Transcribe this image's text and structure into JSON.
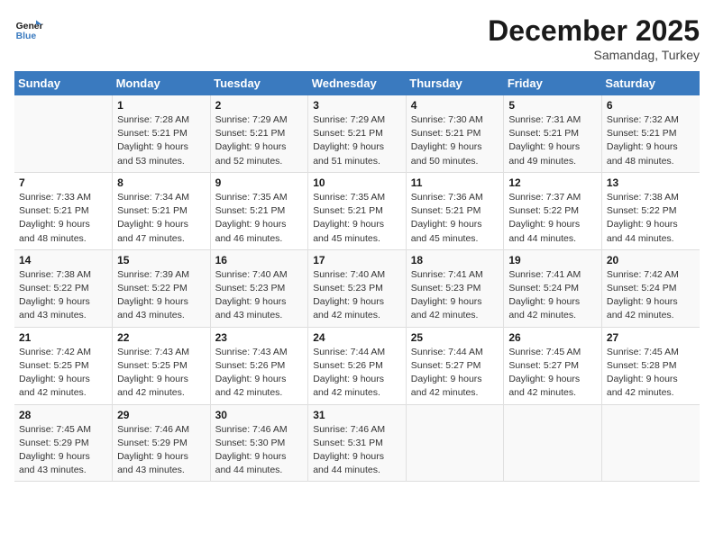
{
  "logo": {
    "line1": "General",
    "line2": "Blue"
  },
  "title": "December 2025",
  "subtitle": "Samandag, Turkey",
  "days_of_week": [
    "Sunday",
    "Monday",
    "Tuesday",
    "Wednesday",
    "Thursday",
    "Friday",
    "Saturday"
  ],
  "weeks": [
    [
      {
        "day": "",
        "info": ""
      },
      {
        "day": "1",
        "info": "Sunrise: 7:28 AM\nSunset: 5:21 PM\nDaylight: 9 hours\nand 53 minutes."
      },
      {
        "day": "2",
        "info": "Sunrise: 7:29 AM\nSunset: 5:21 PM\nDaylight: 9 hours\nand 52 minutes."
      },
      {
        "day": "3",
        "info": "Sunrise: 7:29 AM\nSunset: 5:21 PM\nDaylight: 9 hours\nand 51 minutes."
      },
      {
        "day": "4",
        "info": "Sunrise: 7:30 AM\nSunset: 5:21 PM\nDaylight: 9 hours\nand 50 minutes."
      },
      {
        "day": "5",
        "info": "Sunrise: 7:31 AM\nSunset: 5:21 PM\nDaylight: 9 hours\nand 49 minutes."
      },
      {
        "day": "6",
        "info": "Sunrise: 7:32 AM\nSunset: 5:21 PM\nDaylight: 9 hours\nand 48 minutes."
      }
    ],
    [
      {
        "day": "7",
        "info": "Sunrise: 7:33 AM\nSunset: 5:21 PM\nDaylight: 9 hours\nand 48 minutes."
      },
      {
        "day": "8",
        "info": "Sunrise: 7:34 AM\nSunset: 5:21 PM\nDaylight: 9 hours\nand 47 minutes."
      },
      {
        "day": "9",
        "info": "Sunrise: 7:35 AM\nSunset: 5:21 PM\nDaylight: 9 hours\nand 46 minutes."
      },
      {
        "day": "10",
        "info": "Sunrise: 7:35 AM\nSunset: 5:21 PM\nDaylight: 9 hours\nand 45 minutes."
      },
      {
        "day": "11",
        "info": "Sunrise: 7:36 AM\nSunset: 5:21 PM\nDaylight: 9 hours\nand 45 minutes."
      },
      {
        "day": "12",
        "info": "Sunrise: 7:37 AM\nSunset: 5:22 PM\nDaylight: 9 hours\nand 44 minutes."
      },
      {
        "day": "13",
        "info": "Sunrise: 7:38 AM\nSunset: 5:22 PM\nDaylight: 9 hours\nand 44 minutes."
      }
    ],
    [
      {
        "day": "14",
        "info": "Sunrise: 7:38 AM\nSunset: 5:22 PM\nDaylight: 9 hours\nand 43 minutes."
      },
      {
        "day": "15",
        "info": "Sunrise: 7:39 AM\nSunset: 5:22 PM\nDaylight: 9 hours\nand 43 minutes."
      },
      {
        "day": "16",
        "info": "Sunrise: 7:40 AM\nSunset: 5:23 PM\nDaylight: 9 hours\nand 43 minutes."
      },
      {
        "day": "17",
        "info": "Sunrise: 7:40 AM\nSunset: 5:23 PM\nDaylight: 9 hours\nand 42 minutes."
      },
      {
        "day": "18",
        "info": "Sunrise: 7:41 AM\nSunset: 5:23 PM\nDaylight: 9 hours\nand 42 minutes."
      },
      {
        "day": "19",
        "info": "Sunrise: 7:41 AM\nSunset: 5:24 PM\nDaylight: 9 hours\nand 42 minutes."
      },
      {
        "day": "20",
        "info": "Sunrise: 7:42 AM\nSunset: 5:24 PM\nDaylight: 9 hours\nand 42 minutes."
      }
    ],
    [
      {
        "day": "21",
        "info": "Sunrise: 7:42 AM\nSunset: 5:25 PM\nDaylight: 9 hours\nand 42 minutes."
      },
      {
        "day": "22",
        "info": "Sunrise: 7:43 AM\nSunset: 5:25 PM\nDaylight: 9 hours\nand 42 minutes."
      },
      {
        "day": "23",
        "info": "Sunrise: 7:43 AM\nSunset: 5:26 PM\nDaylight: 9 hours\nand 42 minutes."
      },
      {
        "day": "24",
        "info": "Sunrise: 7:44 AM\nSunset: 5:26 PM\nDaylight: 9 hours\nand 42 minutes."
      },
      {
        "day": "25",
        "info": "Sunrise: 7:44 AM\nSunset: 5:27 PM\nDaylight: 9 hours\nand 42 minutes."
      },
      {
        "day": "26",
        "info": "Sunrise: 7:45 AM\nSunset: 5:27 PM\nDaylight: 9 hours\nand 42 minutes."
      },
      {
        "day": "27",
        "info": "Sunrise: 7:45 AM\nSunset: 5:28 PM\nDaylight: 9 hours\nand 42 minutes."
      }
    ],
    [
      {
        "day": "28",
        "info": "Sunrise: 7:45 AM\nSunset: 5:29 PM\nDaylight: 9 hours\nand 43 minutes."
      },
      {
        "day": "29",
        "info": "Sunrise: 7:46 AM\nSunset: 5:29 PM\nDaylight: 9 hours\nand 43 minutes."
      },
      {
        "day": "30",
        "info": "Sunrise: 7:46 AM\nSunset: 5:30 PM\nDaylight: 9 hours\nand 44 minutes."
      },
      {
        "day": "31",
        "info": "Sunrise: 7:46 AM\nSunset: 5:31 PM\nDaylight: 9 hours\nand 44 minutes."
      },
      {
        "day": "",
        "info": ""
      },
      {
        "day": "",
        "info": ""
      },
      {
        "day": "",
        "info": ""
      }
    ]
  ]
}
